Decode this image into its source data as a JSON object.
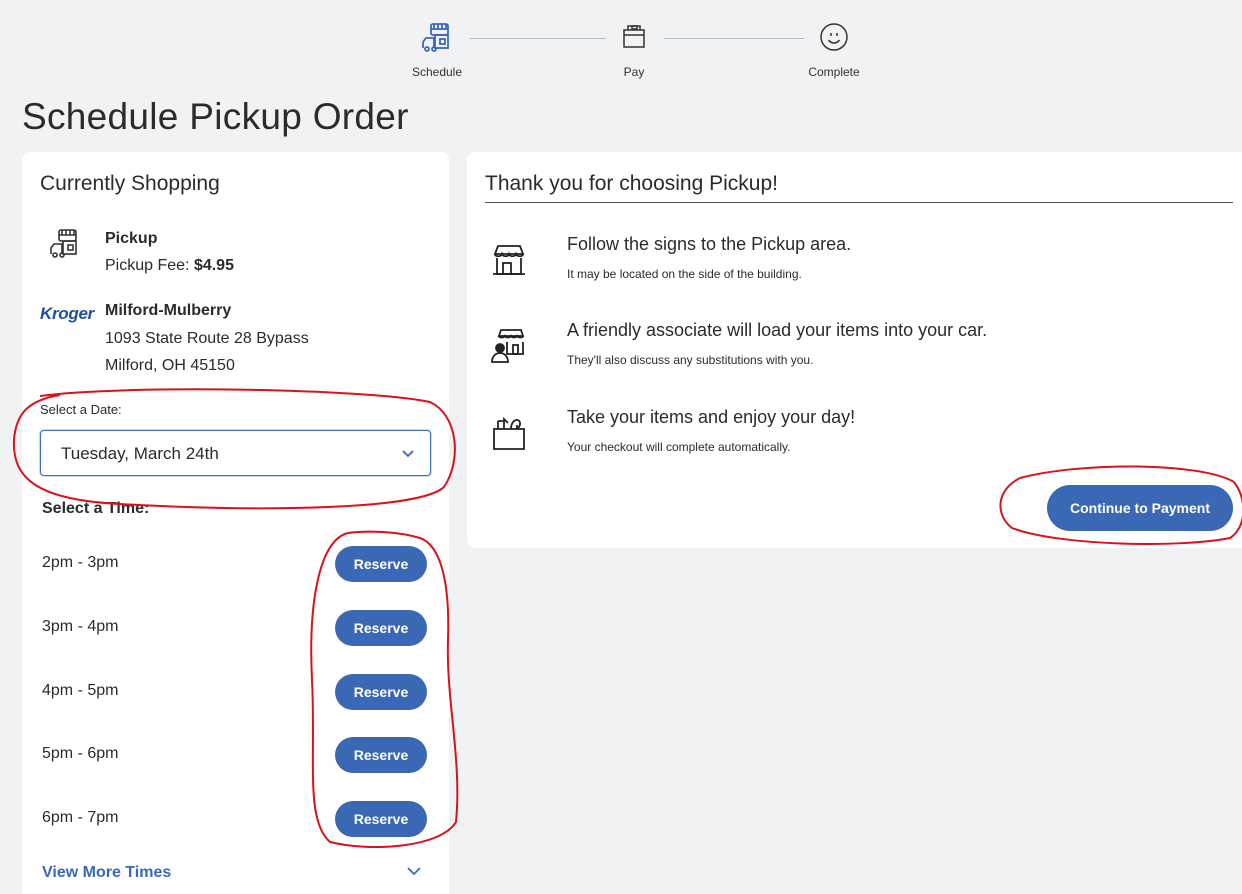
{
  "stepper": {
    "steps": [
      {
        "label": "Schedule",
        "icon": "pickup-store-icon",
        "active": true
      },
      {
        "label": "Pay",
        "icon": "wallet-icon",
        "active": false
      },
      {
        "label": "Complete",
        "icon": "smiley-icon",
        "active": false
      }
    ]
  },
  "page": {
    "title": "Schedule Pickup Order"
  },
  "currently_shopping": {
    "title": "Currently Shopping",
    "mode_label": "Pickup",
    "fee_label": "Pickup Fee:",
    "fee_value": "$4.95",
    "brand_logo": "Kroger",
    "store_name": "Milford-Mulberry",
    "address_line1": "1093 State Route 28 Bypass",
    "address_line2": "Milford, OH 45150"
  },
  "date_picker": {
    "label": "Select a Date:",
    "selected": "Tuesday, March 24th"
  },
  "time_picker": {
    "label": "Select a Time:",
    "slots": [
      {
        "time": "2pm - 3pm",
        "button": "Reserve"
      },
      {
        "time": "3pm - 4pm",
        "button": "Reserve"
      },
      {
        "time": "4pm - 5pm",
        "button": "Reserve"
      },
      {
        "time": "5pm - 6pm",
        "button": "Reserve"
      },
      {
        "time": "6pm - 7pm",
        "button": "Reserve"
      }
    ],
    "more_label": "View More Times"
  },
  "info_card": {
    "title": "Thank you for choosing Pickup!",
    "items": [
      {
        "icon": "storefront-icon",
        "heading": "Follow the signs to the Pickup area.",
        "sub": "It may be located on the side of the building."
      },
      {
        "icon": "associate-icon",
        "heading": "A friendly associate will load your items into your car.",
        "sub": "They'll also discuss any substitutions with you."
      },
      {
        "icon": "grocery-bag-icon",
        "heading": "Take your items and enjoy your day!",
        "sub": "Your checkout will complete automatically."
      }
    ],
    "continue_label": "Continue to Payment"
  },
  "colors": {
    "accent": "#3b68b5",
    "background": "#f1f2f4",
    "annotation": "#d8131b"
  }
}
